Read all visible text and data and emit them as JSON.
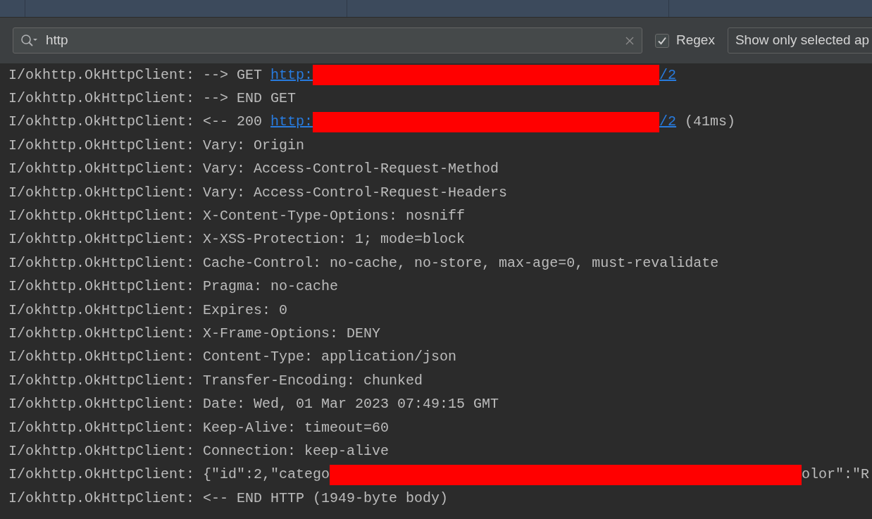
{
  "filter_bar": {
    "search": {
      "value": "http"
    },
    "regex": {
      "label": "Regex",
      "checked": true
    },
    "scope_dropdown": {
      "value": "Show only selected ap"
    }
  },
  "log_lines": [
    {
      "tag": "I/okhttp.OkHttpClient:",
      "parts": [
        {
          "kind": "text",
          "text": "--> GET "
        },
        {
          "kind": "link",
          "text": "http:"
        },
        {
          "kind": "redacted"
        },
        {
          "kind": "link",
          "text": "/2"
        }
      ]
    },
    {
      "tag": "I/okhttp.OkHttpClient:",
      "parts": [
        {
          "kind": "text",
          "text": "--> END GET"
        }
      ]
    },
    {
      "tag": "I/okhttp.OkHttpClient:",
      "parts": [
        {
          "kind": "text",
          "text": "<-- 200 "
        },
        {
          "kind": "link",
          "text": "http:"
        },
        {
          "kind": "redacted"
        },
        {
          "kind": "link",
          "text": "/2"
        },
        {
          "kind": "text",
          "text": " (41ms)"
        }
      ]
    },
    {
      "tag": "I/okhttp.OkHttpClient:",
      "parts": [
        {
          "kind": "text",
          "text": "Vary: Origin"
        }
      ]
    },
    {
      "tag": "I/okhttp.OkHttpClient:",
      "parts": [
        {
          "kind": "text",
          "text": "Vary: Access-Control-Request-Method"
        }
      ]
    },
    {
      "tag": "I/okhttp.OkHttpClient:",
      "parts": [
        {
          "kind": "text",
          "text": "Vary: Access-Control-Request-Headers"
        }
      ]
    },
    {
      "tag": "I/okhttp.OkHttpClient:",
      "parts": [
        {
          "kind": "text",
          "text": "X-Content-Type-Options: nosniff"
        }
      ]
    },
    {
      "tag": "I/okhttp.OkHttpClient:",
      "parts": [
        {
          "kind": "text",
          "text": "X-XSS-Protection: 1; mode=block"
        }
      ]
    },
    {
      "tag": "I/okhttp.OkHttpClient:",
      "parts": [
        {
          "kind": "text",
          "text": "Cache-Control: no-cache, no-store, max-age=0, must-revalidate"
        }
      ]
    },
    {
      "tag": "I/okhttp.OkHttpClient:",
      "parts": [
        {
          "kind": "text",
          "text": "Pragma: no-cache"
        }
      ]
    },
    {
      "tag": "I/okhttp.OkHttpClient:",
      "parts": [
        {
          "kind": "text",
          "text": "Expires: 0"
        }
      ]
    },
    {
      "tag": "I/okhttp.OkHttpClient:",
      "parts": [
        {
          "kind": "text",
          "text": "X-Frame-Options: DENY"
        }
      ]
    },
    {
      "tag": "I/okhttp.OkHttpClient:",
      "parts": [
        {
          "kind": "text",
          "text": "Content-Type: application/json"
        }
      ]
    },
    {
      "tag": "I/okhttp.OkHttpClient:",
      "parts": [
        {
          "kind": "text",
          "text": "Transfer-Encoding: chunked"
        }
      ]
    },
    {
      "tag": "I/okhttp.OkHttpClient:",
      "parts": [
        {
          "kind": "text",
          "text": "Date: Wed, 01 Mar 2023 07:49:15 GMT"
        }
      ]
    },
    {
      "tag": "I/okhttp.OkHttpClient:",
      "parts": [
        {
          "kind": "text",
          "text": "Keep-Alive: timeout=60"
        }
      ]
    },
    {
      "tag": "I/okhttp.OkHttpClient:",
      "parts": [
        {
          "kind": "text",
          "text": "Connection: keep-alive"
        }
      ]
    },
    {
      "tag": "I/okhttp.OkHttpClient:",
      "parts": [
        {
          "kind": "text",
          "text": "{\"id\":2,\"catego"
        },
        {
          "kind": "redacted"
        },
        {
          "kind": "text",
          "text": "olor\":\"R"
        }
      ]
    },
    {
      "tag": "I/okhttp.OkHttpClient:",
      "parts": [
        {
          "kind": "text",
          "text": "<-- END HTTP (1949-byte body)"
        }
      ]
    }
  ]
}
